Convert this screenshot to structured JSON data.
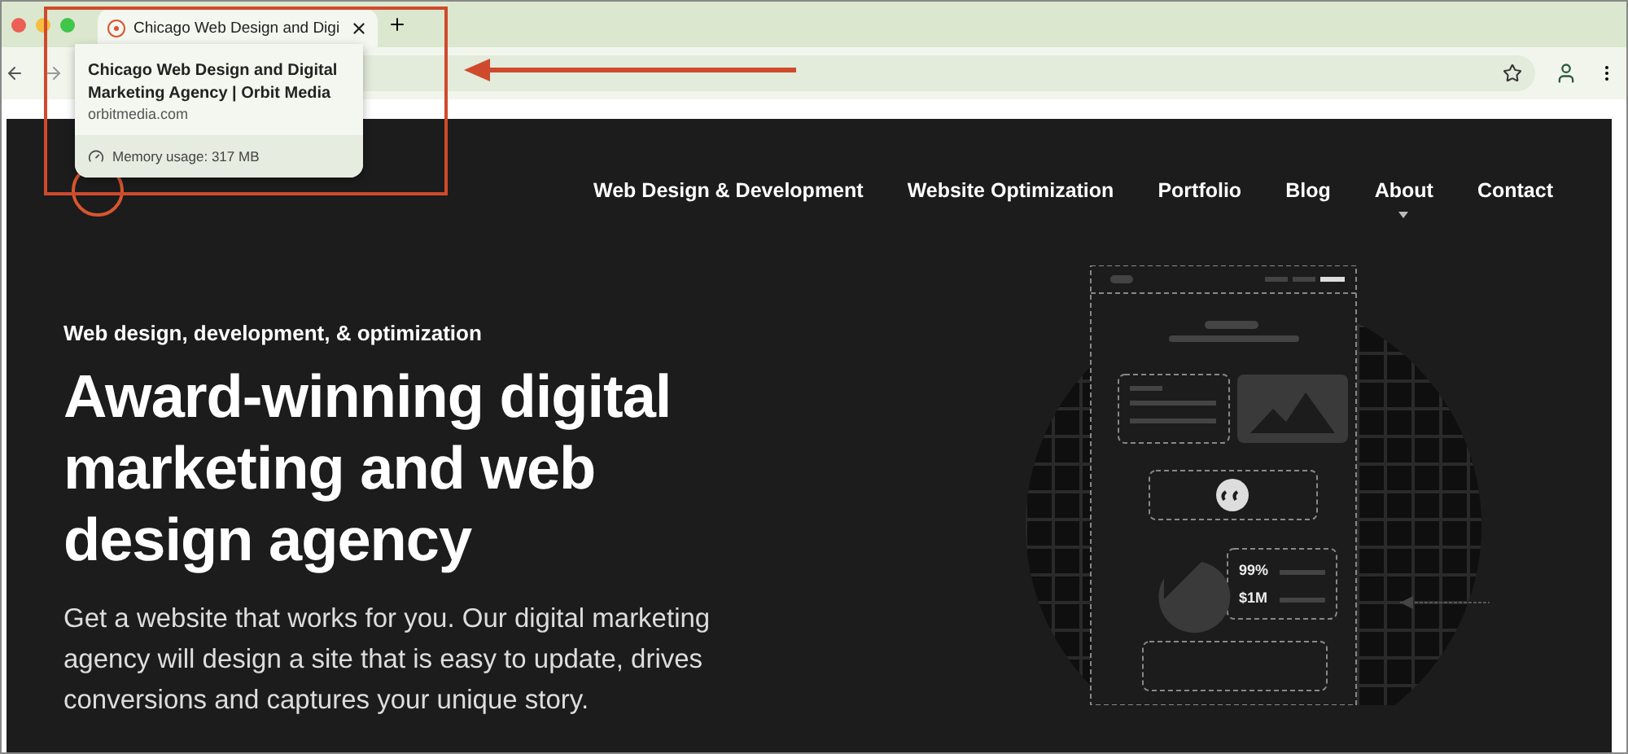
{
  "browser": {
    "tab": {
      "title": "Chicago Web Design and Digi",
      "selected": true
    },
    "tooltip": {
      "title": "Chicago Web Design and Digital Marketing Agency | Orbit Media",
      "domain": "orbitmedia.com",
      "memory": "Memory usage: 317 MB"
    }
  },
  "nav": [
    {
      "label": "Web Design & Development",
      "dropdown": false
    },
    {
      "label": "Website Optimization",
      "dropdown": false
    },
    {
      "label": "Portfolio",
      "dropdown": false
    },
    {
      "label": "Blog",
      "dropdown": false
    },
    {
      "label": "About",
      "dropdown": true
    },
    {
      "label": "Contact",
      "dropdown": false
    }
  ],
  "hero": {
    "eyebrow": "Web design, development, & optimization",
    "headline": "Award-winning digital marketing and web design agency",
    "body": "Get a website that works for you. Our digital marketing agency will design a site that is easy to update, drives conversions and captures your unique story."
  },
  "illustration": {
    "stats": [
      "99%",
      "$1M"
    ]
  }
}
